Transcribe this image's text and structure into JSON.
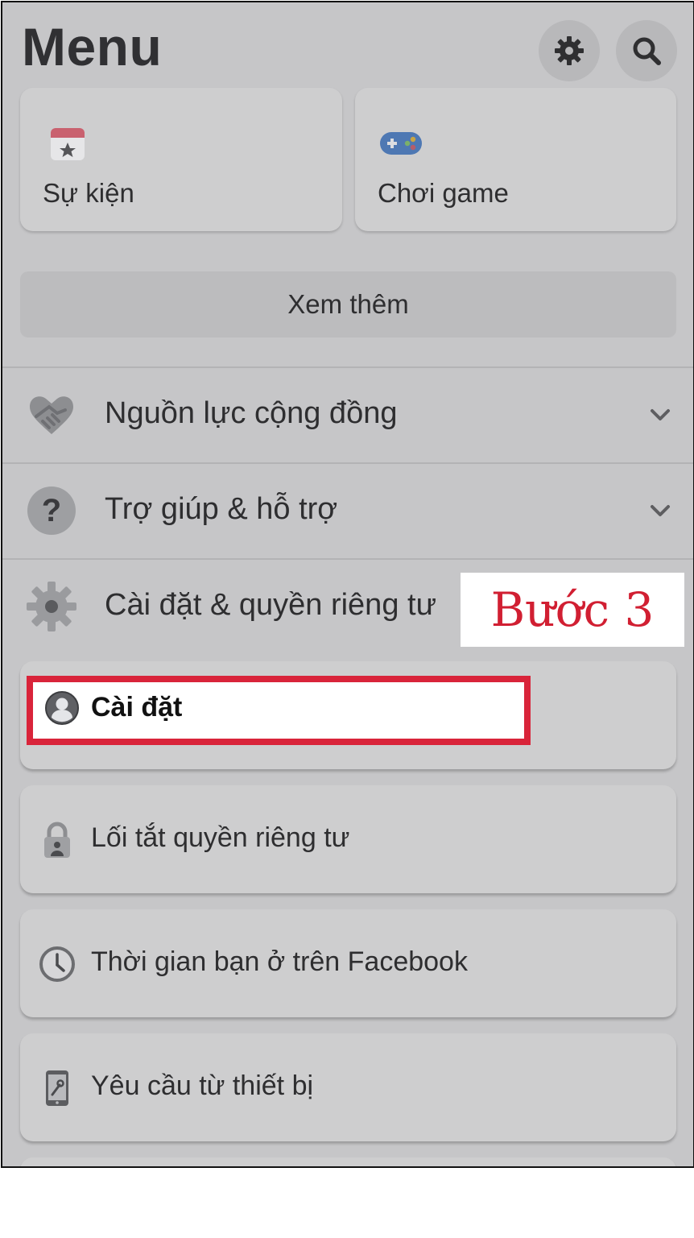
{
  "header": {
    "title": "Menu",
    "settings_icon": "gear-icon",
    "search_icon": "search-icon"
  },
  "shortcuts": [
    {
      "label": "Sự kiện",
      "icon": "calendar-star-icon"
    },
    {
      "label": "Chơi game",
      "icon": "gamepad-icon"
    }
  ],
  "see_more_label": "Xem thêm",
  "sections": [
    {
      "label": "Nguồn lực cộng đồng",
      "icon": "handshake-icon",
      "expandable": true
    },
    {
      "label": "Trợ giúp & hỗ trợ",
      "icon": "question-icon",
      "expandable": true
    },
    {
      "label": "Cài đặt & quyền riêng tư",
      "icon": "gear-icon",
      "expandable": false
    }
  ],
  "settings_items": [
    {
      "label": "Cài đặt",
      "icon": "user-circle-icon",
      "highlighted": true
    },
    {
      "label": "Lối tắt quyền riêng tư",
      "icon": "lock-icon"
    },
    {
      "label": "Thời gian bạn ở trên Facebook",
      "icon": "clock-icon"
    },
    {
      "label": "Yêu cầu từ thiết bị",
      "icon": "phone-icon"
    }
  ],
  "annotation": {
    "step_label": "Bước 3",
    "color": "#d11f32",
    "highlight_color": "#d9243a"
  },
  "colors": {
    "dimmed_background": "#c6c6c8",
    "card": "#cececf"
  }
}
